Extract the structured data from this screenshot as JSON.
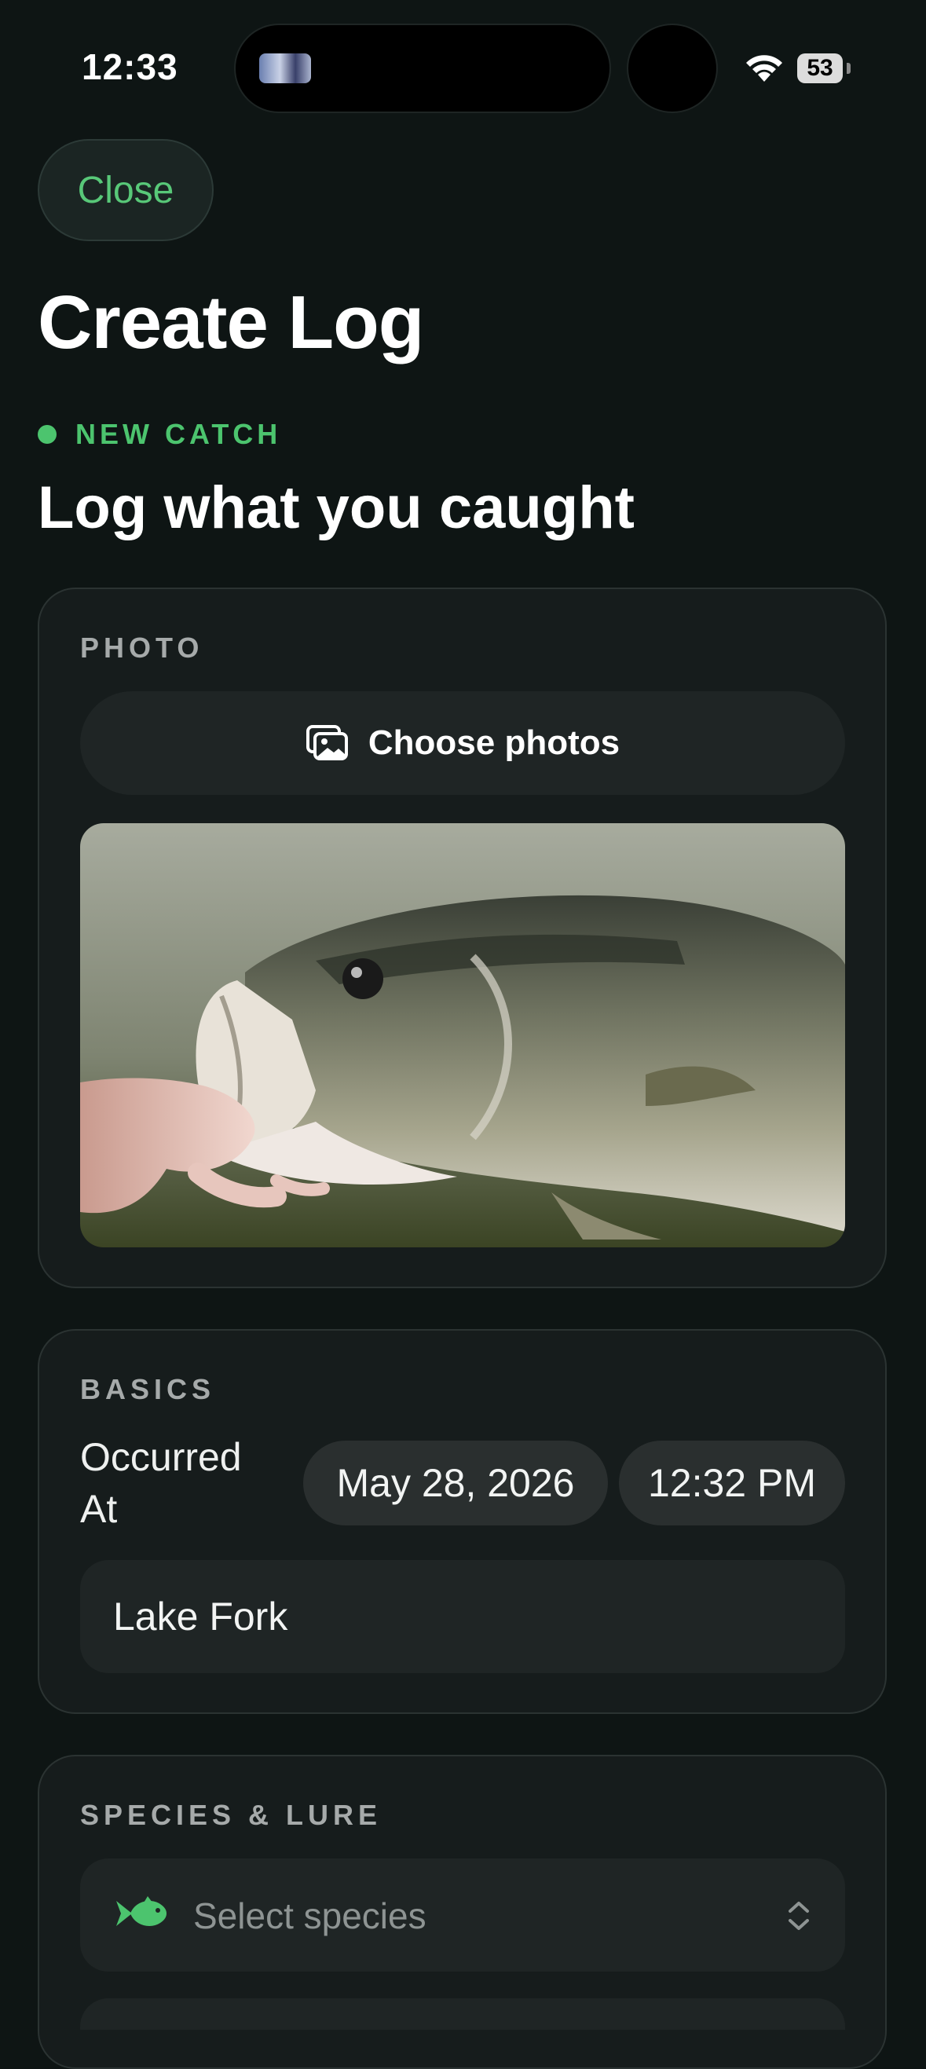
{
  "status_bar": {
    "time": "12:33",
    "battery": "53",
    "wifi_icon": "wifi-icon"
  },
  "nav": {
    "close_label": "Close"
  },
  "page": {
    "title": "Create Log",
    "eyebrow": "NEW CATCH",
    "subtitle": "Log what you caught"
  },
  "photo_section": {
    "label": "PHOTO",
    "choose_button_label": "Choose photos",
    "choose_icon": "photos-icon",
    "image_subject": "largemouth-bass-held-by-hand"
  },
  "basics_section": {
    "label": "BASICS",
    "occurred_at_label": "Occurred At",
    "date_value": "May 28, 2026",
    "time_value": "12:32 PM",
    "location_value": "Lake Fork"
  },
  "species_section": {
    "label": "SPECIES & LURE",
    "species_placeholder": "Select species",
    "species_icon": "fish-icon",
    "chevron_icon": "chevron-up-down-icon"
  },
  "colors": {
    "background": "#0e1514",
    "accent_green": "#4cc46e",
    "card": "#161c1c",
    "field": "#1f2525"
  }
}
